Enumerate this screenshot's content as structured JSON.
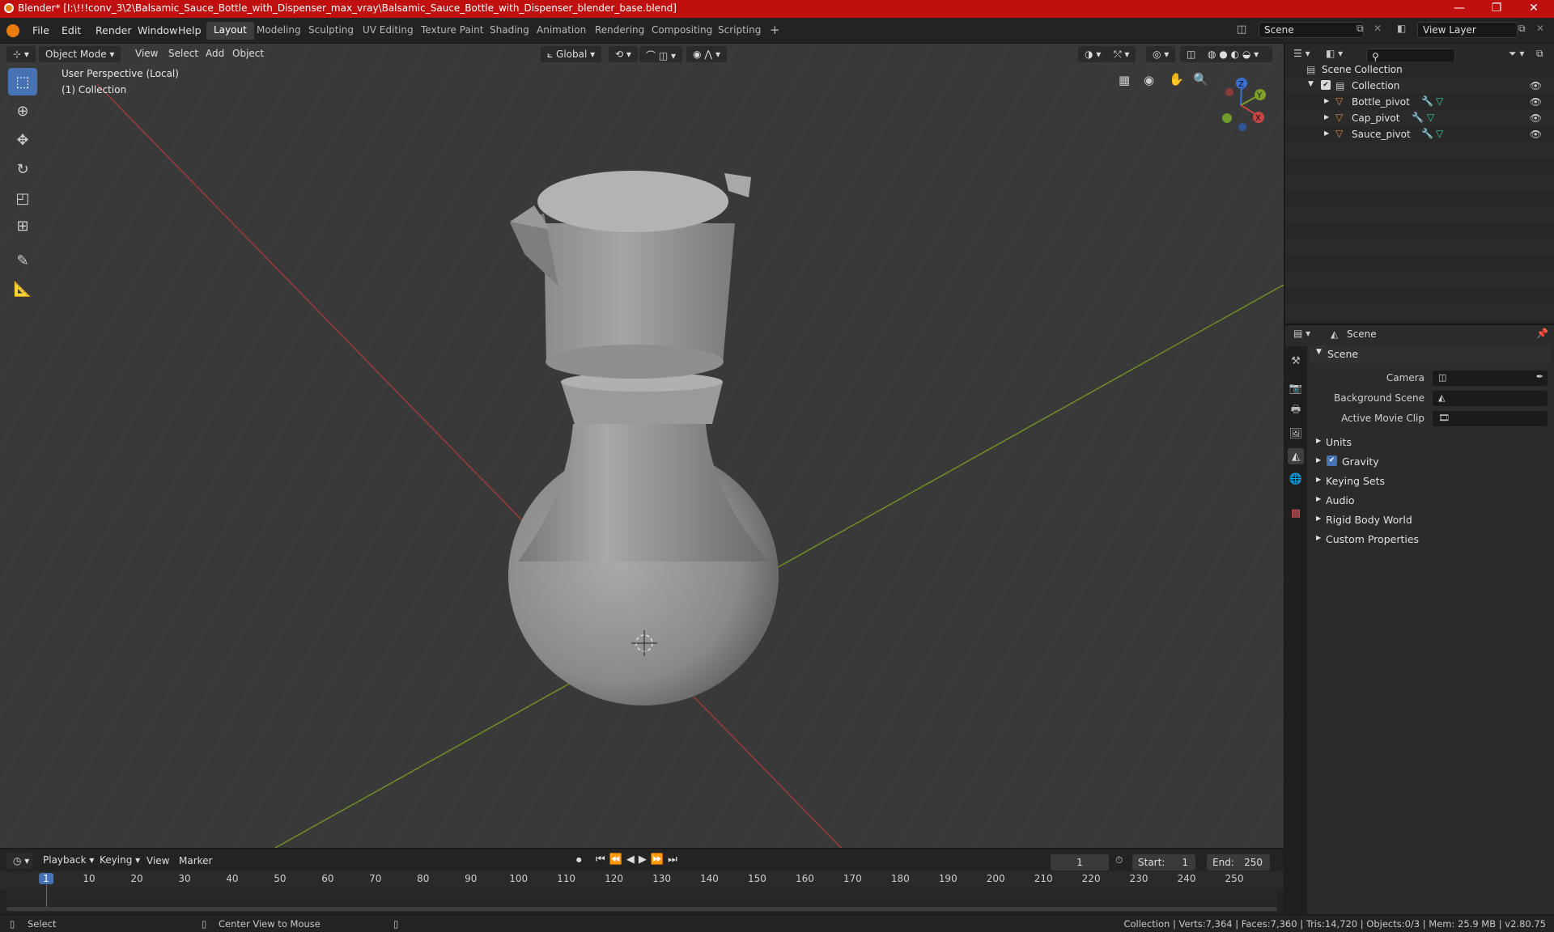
{
  "window": {
    "title": "Blender* [I:\\!!!conv_3\\2\\Balsamic_Sauce_Bottle_with_Dispenser_max_vray\\Balsamic_Sauce_Bottle_with_Dispenser_blender_base.blend]",
    "minimize": "—",
    "maximize": "❐",
    "close": "✕"
  },
  "menu": {
    "file": "File",
    "edit": "Edit",
    "render": "Render",
    "window": "Window",
    "help": "Help"
  },
  "workspaces": [
    "Layout",
    "Modeling",
    "Sculpting",
    "UV Editing",
    "Texture Paint",
    "Shading",
    "Animation",
    "Rendering",
    "Compositing",
    "Scripting"
  ],
  "add_workspace": "+",
  "scene_field": "Scene",
  "view_layer_field": "View Layer",
  "viewport_header": {
    "mode": "Object Mode",
    "view": "View",
    "select": "Select",
    "add": "Add",
    "object": "Object",
    "transform_orientation": "Global"
  },
  "viewport": {
    "perspective": "User Perspective (Local)",
    "collection": "(1) Collection",
    "gizmo": {
      "x": "X",
      "y": "Y",
      "z": "Z"
    }
  },
  "outliner": {
    "search_placeholder": "",
    "scene_collection": "Scene Collection",
    "collection": "Collection",
    "items": [
      {
        "name": "Bottle_pivot"
      },
      {
        "name": "Cap_pivot"
      },
      {
        "name": "Sauce_pivot"
      }
    ]
  },
  "properties": {
    "header": "Scene",
    "panel_scene": "Scene",
    "camera_label": "Camera",
    "background_scene_label": "Background Scene",
    "active_movie_clip_label": "Active Movie Clip",
    "panels": [
      "Units",
      "Gravity",
      "Keying Sets",
      "Audio",
      "Rigid Body World",
      "Custom Properties"
    ],
    "gravity_checked": true
  },
  "timeline": {
    "playback": "Playback",
    "keying": "Keying",
    "view": "View",
    "marker": "Marker",
    "current_frame": "1",
    "start_label": "Start:",
    "start_value": "1",
    "end_label": "End:",
    "end_value": "250",
    "ruler": [
      "1",
      "10",
      "20",
      "30",
      "40",
      "50",
      "60",
      "70",
      "80",
      "90",
      "100",
      "110",
      "120",
      "130",
      "140",
      "150",
      "160",
      "170",
      "180",
      "190",
      "200",
      "210",
      "220",
      "230",
      "240",
      "250"
    ]
  },
  "statusbar": {
    "select": "Select",
    "center_view": "Center View to Mouse",
    "stats": "Collection | Verts:7,364 | Faces:7,360 | Tris:14,720 | Objects:0/3 | Mem: 25.9 MB | v2.80.75"
  },
  "colors": {
    "accent": "#4772b3",
    "title_bar": "#c00f0f",
    "axis_x": "#b83c3c",
    "axis_y": "#7fa12a"
  }
}
